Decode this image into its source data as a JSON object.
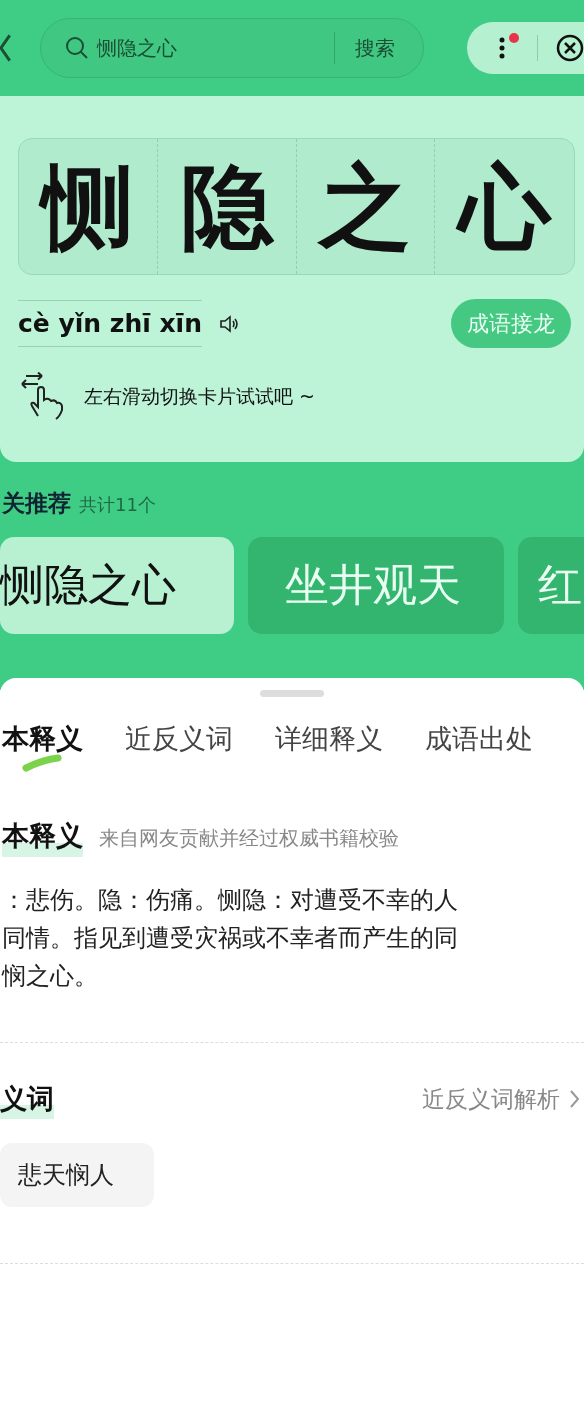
{
  "search": {
    "value": "恻隐之心",
    "button": "搜索"
  },
  "menu": {
    "has_notification": true
  },
  "idiom": {
    "characters": [
      "恻",
      "隐",
      "之",
      "心"
    ],
    "pinyin": "cè yǐn zhī xīn",
    "action": "成语接龙",
    "hint": "左右滑动切换卡片试试吧 ~"
  },
  "related": {
    "title": "关推荐",
    "count": "共计11个",
    "cards": [
      {
        "text": "恻隐之心",
        "selected": true
      },
      {
        "text": "坐井观天",
        "selected": false
      },
      {
        "text": "红",
        "selected": false
      }
    ]
  },
  "tabs": [
    {
      "label": "本释义",
      "selected": true
    },
    {
      "label": "近反义词",
      "selected": false
    },
    {
      "label": "详细释义",
      "selected": false
    },
    {
      "label": "成语出处",
      "selected": false
    }
  ],
  "definition": {
    "title": "本释义",
    "source": "来自网友贡献并经过权威书籍校验",
    "lines": [
      "：悲伤。隐：伤痛。恻隐：对遭受不幸的人",
      "同情。指见到遭受灾祸或不幸者而产生的同",
      "悯之心。"
    ]
  },
  "synonyms": {
    "title": "义词",
    "link": "近反义词解析",
    "items": [
      "悲天悯人"
    ]
  }
}
